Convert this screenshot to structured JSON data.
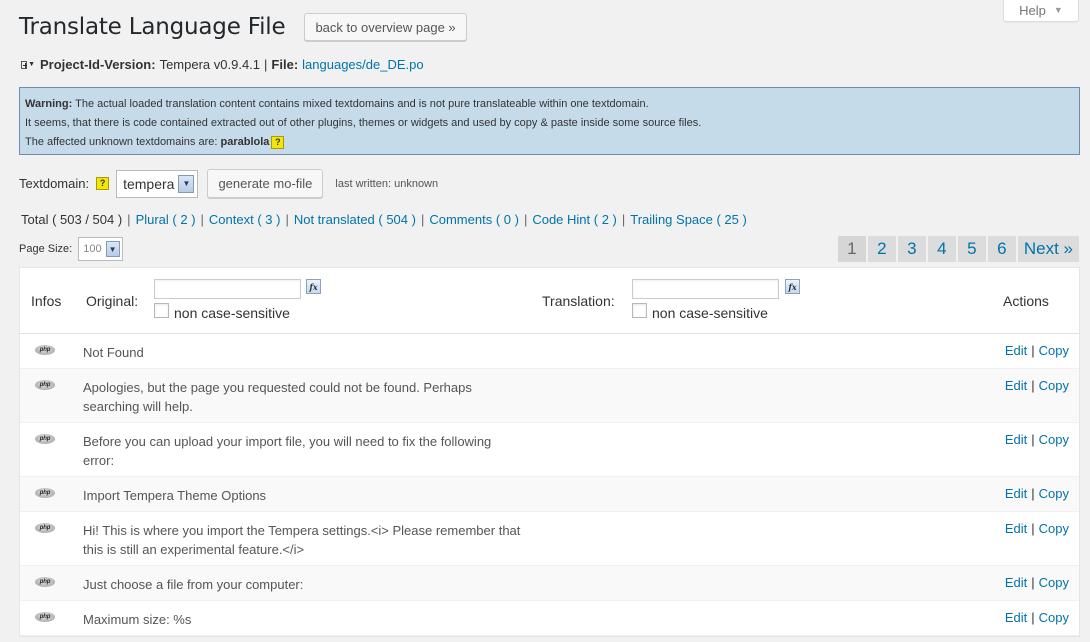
{
  "help": {
    "label": "Help"
  },
  "header": {
    "title": "Translate Language File",
    "back_label": "back to overview page »"
  },
  "project": {
    "label": "Project-Id-Version:",
    "version": "Tempera v0.9.4.1",
    "file_label": "File:",
    "file_link": "languages/de_DE.po"
  },
  "warning": {
    "label": "Warning:",
    "line1": "The actual loaded translation content contains mixed textdomains and is not pure translateable within one textdomain.",
    "line2": "It seems, that there is code contained extracted out of other plugins, themes or widgets and used by copy & paste inside some source files.",
    "line3": "The affected unknown textdomains are:",
    "domains": "parablola",
    "help_icon": "?"
  },
  "textdomain": {
    "label": "Textdomain:",
    "help_icon": "?",
    "selected": "tempera",
    "generate_label": "generate mo-file",
    "last_written": "last written:  unknown"
  },
  "filters": {
    "total": "Total ( 503 / 504 )",
    "plural": "Plural ( 2 )",
    "context": "Context ( 3 )",
    "not_translated": "Not translated ( 504 )",
    "comments": "Comments ( 0 )",
    "code_hint": "Code Hint ( 2 )",
    "trailing_space": "Trailing Space ( 25 )",
    "separator": "|"
  },
  "page_size": {
    "label": "Page Size:",
    "value": "100"
  },
  "pager": {
    "pages": [
      "1",
      "2",
      "3",
      "4",
      "5",
      "6"
    ],
    "next": "Next »",
    "active": "1"
  },
  "table": {
    "headers": {
      "infos": "Infos",
      "original": "Original:",
      "translation": "Translation:",
      "actions": "Actions",
      "case_label": "non case-sensitive",
      "fx": "fx"
    },
    "rows": [
      {
        "icon": "php",
        "original": "Not Found",
        "edit": "Edit",
        "copy": "Copy"
      },
      {
        "icon": "php",
        "original": "Apologies, but the page you requested could not be found. Perhaps searching will help.",
        "edit": "Edit",
        "copy": "Copy"
      },
      {
        "icon": "php",
        "original": "Before you can upload your import file, you will need to fix the following error:",
        "edit": "Edit",
        "copy": "Copy"
      },
      {
        "icon": "php",
        "original": "Import Tempera Theme Options",
        "edit": "Edit",
        "copy": "Copy"
      },
      {
        "icon": "php",
        "original": "Hi! This is where you import the Tempera settings.<i> Please remember that this is still an experimental feature.</i>",
        "edit": "Edit",
        "copy": "Copy"
      },
      {
        "icon": "php",
        "original": "Just choose a file from your computer:",
        "edit": "Edit",
        "copy": "Copy"
      },
      {
        "icon": "php",
        "original": "Maximum size: %s",
        "edit": "Edit",
        "copy": "Copy"
      }
    ]
  },
  "colors": {
    "link": "#0073aa",
    "warning_bg": "#c6dbea",
    "help_icon": "#f4e60a"
  }
}
